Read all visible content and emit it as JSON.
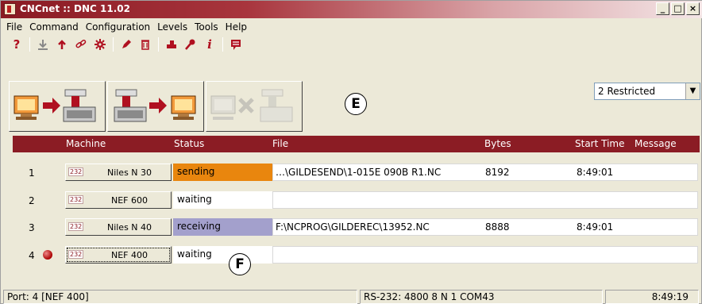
{
  "window": {
    "title": "CNCnet :: DNC 11.02",
    "controls": {
      "minimize": "_",
      "maximize": "□",
      "close": "×"
    }
  },
  "menu": [
    "File",
    "Command",
    "Configuration",
    "Levels",
    "Tools",
    "Help"
  ],
  "toolbar": {
    "icons": [
      "help-icon",
      "download-icon",
      "upload-icon",
      "link-icon",
      "settings-gear-icon",
      "edit-pen-icon",
      "delete-trash-icon",
      "machine-icon",
      "key-icon",
      "info-icon",
      "message-icon"
    ]
  },
  "big_buttons": [
    "send-to-machine",
    "receive-from-machine",
    "cancel-transfer"
  ],
  "annotations": {
    "e": "E",
    "f": "F"
  },
  "level_select": {
    "value": "2 Restricted"
  },
  "table": {
    "headers": {
      "machine": "Machine",
      "status": "Status",
      "file": "File",
      "bytes": "Bytes",
      "start_time": "Start Time",
      "message": "Message"
    },
    "rows": [
      {
        "num": "1",
        "port": "232",
        "machine": "Niles N 30",
        "status": "sending",
        "file": "…\\GILDESEND\\1-015E 090B R1.NC",
        "bytes": "8192",
        "start": "8:49:01"
      },
      {
        "num": "2",
        "port": "232",
        "machine": "NEF 600",
        "status": "waiting",
        "file": "",
        "bytes": "",
        "start": ""
      },
      {
        "num": "3",
        "port": "232",
        "machine": "Niles N 40",
        "status": "receiving",
        "file": "F:\\NCPROG\\GILDEREC\\13952.NC",
        "bytes": "8888",
        "start": "8:49:01"
      },
      {
        "num": "4",
        "port": "232",
        "machine": "NEF 400",
        "status": "waiting",
        "file": "",
        "bytes": "",
        "start": ""
      }
    ]
  },
  "statusbar": {
    "port": "Port: 4 [NEF 400]",
    "serial": "RS-232: 4800 8 N 1 COM43",
    "time": "8:49:19"
  },
  "colors": {
    "header": "#8b1c24",
    "sending": "#e9860e",
    "receiving": "#a3a0cc"
  }
}
